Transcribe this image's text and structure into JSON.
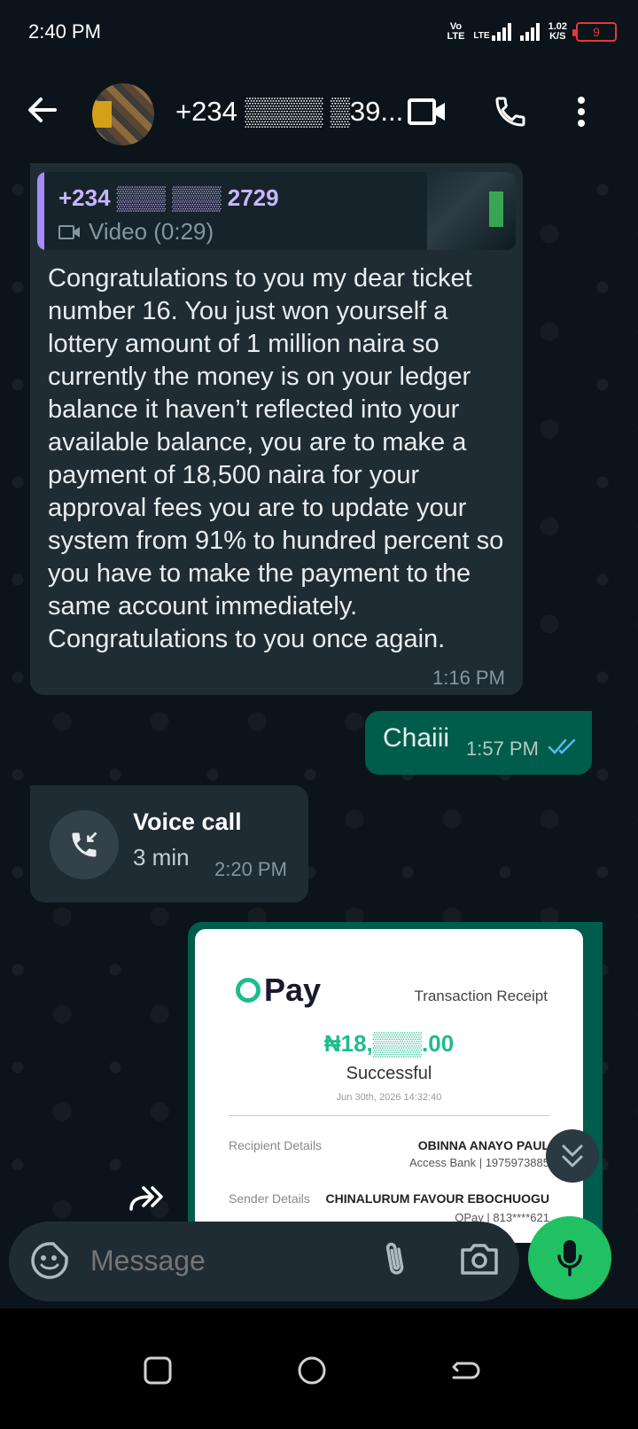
{
  "status_bar": {
    "time": "2:40 PM",
    "net1_top": "Vo",
    "net1_bottom": "LTE",
    "net2": "LTE",
    "speed_top": "1.02",
    "speed_bottom": "K/S",
    "battery": "9"
  },
  "header": {
    "contact_name": "+234  ▒▒▒▒ ▒39..."
  },
  "messages": {
    "m1": {
      "quote_sender": "+234 ▒▒▒ ▒▒▒ 2729",
      "quote_media": "Video (0:29)",
      "text": "Congratulations to you my dear ticket number 16. You just won yourself a lottery amount of 1 million naira so currently the money is on your ledger balance it haven’t reflected into your available balance, you are to make a payment of 18,500 naira for your approval fees you are to update your system from 91% to hundred percent so you have to make the payment to the same account immediately. Congratulations to you once again.",
      "time": "1:16 PM"
    },
    "m2": {
      "text": "Chaiii",
      "time": "1:57 PM"
    },
    "m3": {
      "title": "Voice call",
      "duration": "3 min",
      "time": "2:20 PM"
    },
    "m4": {
      "brand": "Pay",
      "title": "Transaction Receipt",
      "amount": "₦18,▒▒▒.00",
      "status": "Successful",
      "date": "Jun 30th, 2026 14:32:40",
      "recipient_label": "Recipient Details",
      "recipient_name": "OBINNA ANAYO PAUL",
      "recipient_bank": "Access Bank | 1975973885",
      "sender_label": "Sender Details",
      "sender_name": "CHINALURUM FAVOUR EBOCHUOGU",
      "sender_bank": "OPay | 813****621"
    }
  },
  "composer": {
    "placeholder": "Message"
  },
  "colors": {
    "accent_green": "#21c063",
    "outgoing_bubble": "#005c4b",
    "incoming_bubble": "#1f2c34",
    "read_ticks": "#53bdeb"
  }
}
